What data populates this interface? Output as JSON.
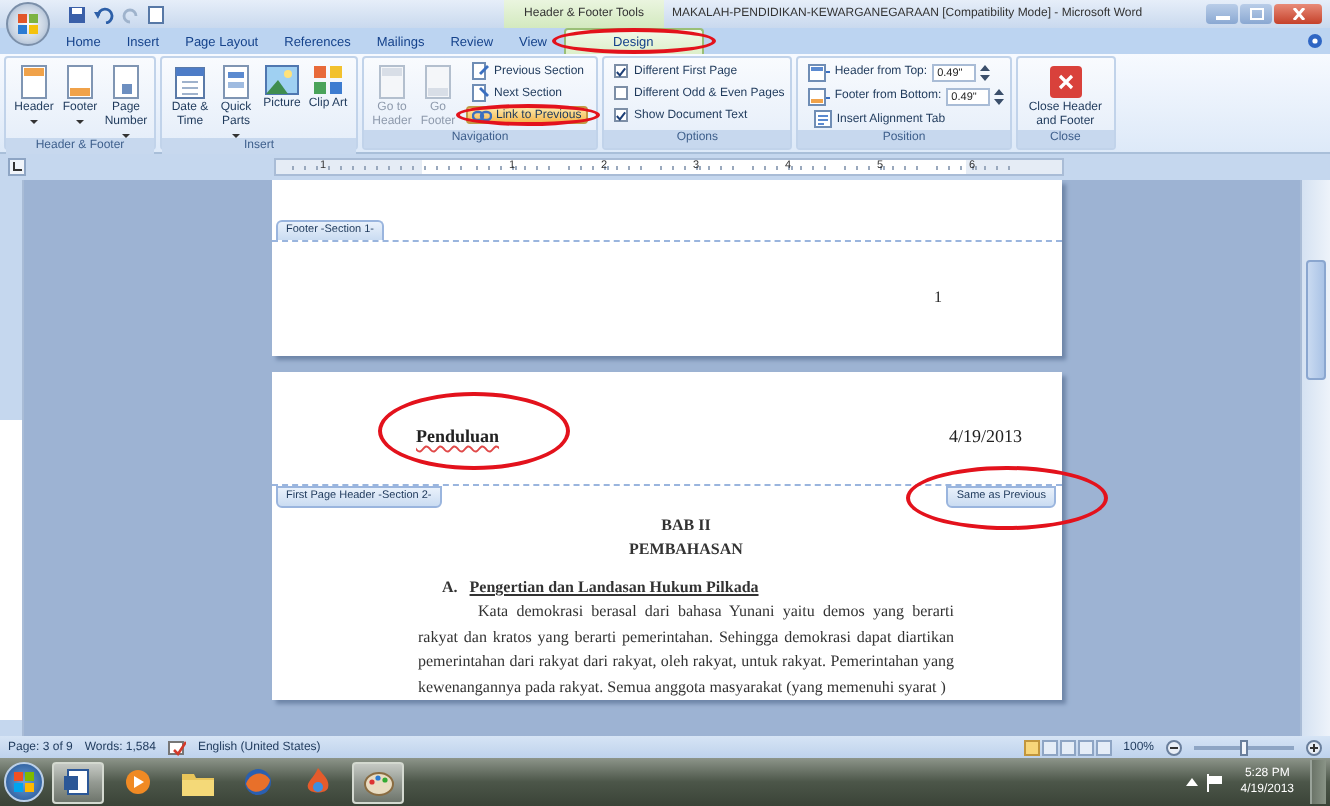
{
  "window": {
    "context_label": "Header & Footer Tools",
    "title": "MAKALAH-PENDIDIKAN-KEWARGANEGARAAN [Compatibility Mode] - Microsoft Word"
  },
  "tabs": [
    {
      "label": "Home",
      "selected": false,
      "circled": false
    },
    {
      "label": "Insert",
      "selected": false,
      "circled": false
    },
    {
      "label": "Page Layout",
      "selected": false,
      "circled": false
    },
    {
      "label": "References",
      "selected": false,
      "circled": false
    },
    {
      "label": "Mailings",
      "selected": false,
      "circled": false
    },
    {
      "label": "Review",
      "selected": false,
      "circled": false
    },
    {
      "label": "View",
      "selected": false,
      "circled": false
    },
    {
      "label": "Design",
      "selected": true,
      "circled": true
    }
  ],
  "ribbon": {
    "groups": [
      {
        "name": "Header & Footer",
        "items": [
          {
            "kind": "large",
            "label": "Header",
            "dropdown": true,
            "disabled": false
          },
          {
            "kind": "large",
            "label": "Footer",
            "dropdown": true,
            "disabled": false
          },
          {
            "kind": "large",
            "label": "Page Number",
            "dropdown": true,
            "disabled": false
          }
        ]
      },
      {
        "name": "Insert",
        "items": [
          {
            "kind": "large",
            "label": "Date & Time",
            "dropdown": false,
            "disabled": false
          },
          {
            "kind": "large",
            "label": "Quick Parts",
            "dropdown": true,
            "disabled": false
          },
          {
            "kind": "large",
            "label": "Picture",
            "dropdown": false,
            "disabled": false
          },
          {
            "kind": "large",
            "label": "Clip Art",
            "dropdown": false,
            "disabled": false
          }
        ]
      },
      {
        "name": "Navigation",
        "items": [
          {
            "kind": "large",
            "label": "Go to Header",
            "dropdown": false,
            "disabled": true
          },
          {
            "kind": "large",
            "label": "Go Footer",
            "dropdown": false,
            "disabled": true
          },
          {
            "kind": "small",
            "label": "Previous Section",
            "on": false,
            "circled": false
          },
          {
            "kind": "small",
            "label": "Next Section",
            "on": false,
            "circled": false
          },
          {
            "kind": "small",
            "label": "Link to Previous",
            "on": true,
            "circled": true
          }
        ]
      },
      {
        "name": "Options",
        "items": [
          {
            "kind": "check",
            "label": "Different First Page",
            "checked": true
          },
          {
            "kind": "check",
            "label": "Different Odd & Even Pages",
            "checked": false
          },
          {
            "kind": "check",
            "label": "Show Document Text",
            "checked": true
          }
        ]
      },
      {
        "name": "Position",
        "items": [
          {
            "kind": "spin",
            "label": "Header from Top:",
            "value": "0.49\""
          },
          {
            "kind": "spin",
            "label": "Footer from Bottom:",
            "value": "0.49\""
          },
          {
            "kind": "small",
            "label": "Insert Alignment Tab",
            "on": false,
            "circled": false
          }
        ]
      },
      {
        "name": "Close",
        "items": [
          {
            "kind": "large",
            "label": "Close Header and Footer",
            "dropdown": false,
            "disabled": false
          }
        ]
      }
    ]
  },
  "ruler": {
    "labels": [
      "1",
      "1",
      "2",
      "3",
      "4",
      "5",
      "6"
    ]
  },
  "document": {
    "footer": {
      "tab": "Footer -Section 1-",
      "text": "1"
    },
    "header": {
      "left": "Penduluan",
      "left_circled": true,
      "right": "4/19/2013",
      "tab": "First Page Header -Section 2-",
      "link_tab": "Same as Previous",
      "link_circled": true
    },
    "body": [
      {
        "kind": "title",
        "text": "BAB II"
      },
      {
        "kind": "title",
        "text": "PEMBAHASAN"
      },
      {
        "kind": "heading",
        "number": "A.",
        "text": "Pengertian dan Landasan Hukum Pilkada"
      },
      {
        "kind": "paragraph",
        "text": "Kata demokrasi berasal dari bahasa Yunani yaitu demos yang berarti rakyat dan kratos yang berarti pemerintahan. Sehingga demokrasi dapat diartikan pemerintahan dari rakyat dari rakyat, oleh rakyat, untuk rakyat. Pemerintahan yang kewenangannya pada rakyat. Semua anggota masyarakat (yang memenuhi syarat )"
      }
    ]
  },
  "status_bar": {
    "page": "Page: 3 of 9",
    "words": "Words: 1,584",
    "language": "English (United States)",
    "views": [
      {
        "selected": true
      },
      {
        "selected": false
      },
      {
        "selected": false
      },
      {
        "selected": false
      },
      {
        "selected": false
      }
    ],
    "zoom": "100%",
    "zoom_slider": {
      "level": 0.5
    }
  },
  "taskbar": {
    "apps": [
      {
        "active": true
      },
      {
        "active": false
      },
      {
        "active": false
      },
      {
        "active": false
      },
      {
        "active": false
      },
      {
        "active": true
      }
    ],
    "time": "5:28 PM",
    "date": "4/19/2013"
  }
}
